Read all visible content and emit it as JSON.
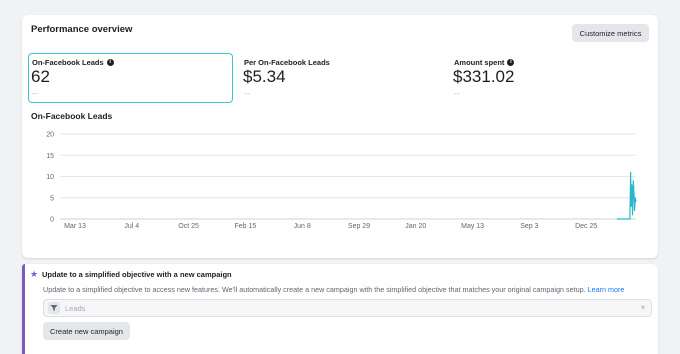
{
  "performance": {
    "title": "Performance overview",
    "customize_label": "Customize metrics",
    "metrics": [
      {
        "label": "On-Facebook Leads",
        "value": "62",
        "compare": "--",
        "has_info": true,
        "selected": true
      },
      {
        "label": "Per On-Facebook Leads",
        "value": "$5.34",
        "compare": "--",
        "has_info": false,
        "selected": false
      },
      {
        "label": "Amount spent",
        "value": "$331.02",
        "compare": "--",
        "has_info": true,
        "selected": false
      }
    ]
  },
  "chart_data": {
    "type": "line",
    "title": "On-Facebook Leads",
    "xlabel": "",
    "ylabel": "",
    "ylim": [
      0,
      20
    ],
    "yticks": [
      0,
      5,
      10,
      15,
      20
    ],
    "xticks": [
      "Mar 13",
      "Jul 4",
      "Oct 25",
      "Feb 15",
      "Jun 8",
      "Sep 29",
      "Jan 20",
      "May 13",
      "Sep 3",
      "Dec 25"
    ],
    "grid": true,
    "color": "#2ab7c9",
    "series": [
      {
        "values": [
          0,
          0,
          0,
          0,
          0,
          0,
          0,
          0,
          0,
          0,
          0,
          0,
          0,
          0,
          0,
          0,
          0,
          0,
          0,
          0,
          11,
          3,
          8,
          1,
          9,
          6,
          2,
          5,
          4
        ]
      }
    ]
  },
  "objective": {
    "title": "Update to a simplified objective with a new campaign",
    "description": "Update to a simplified objective to access new features. We'll automatically create a new campaign with the simplified objective that matches your original campaign setup.",
    "learn_more": "Learn more",
    "select_value": "Leads",
    "create_label": "Create new campaign",
    "accent_color": "#7b5cc4"
  }
}
